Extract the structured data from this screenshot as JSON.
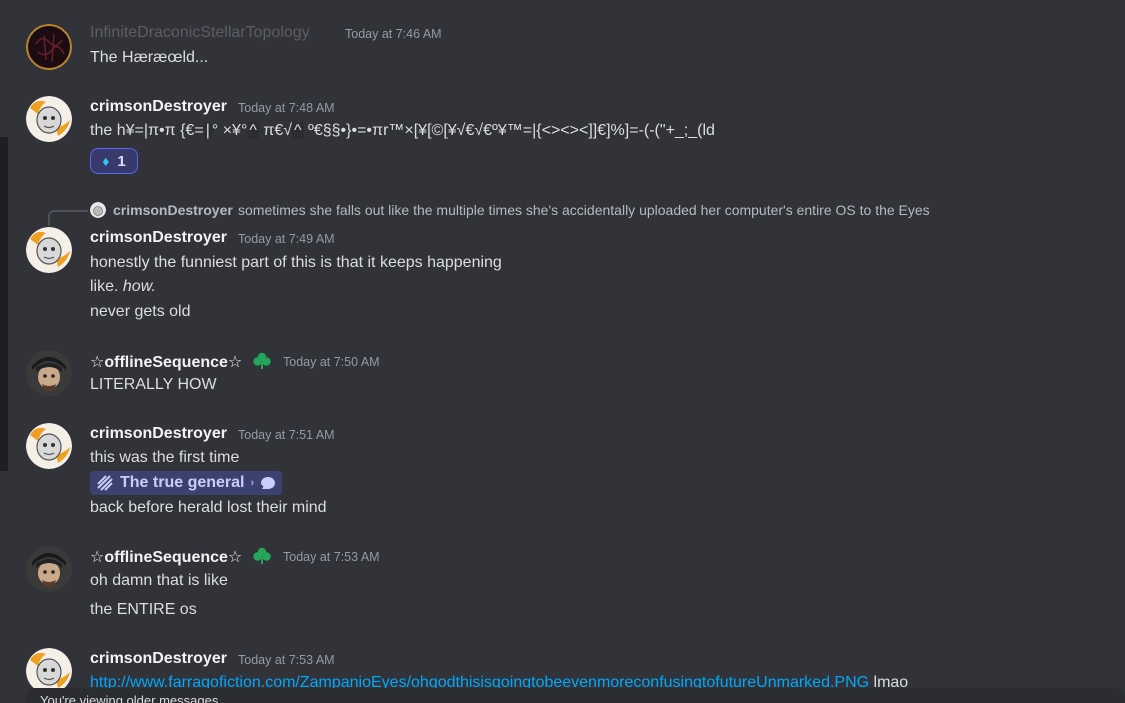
{
  "messages": [
    {
      "author": "InfiniteDraconicStellarTopology",
      "time": "Today at 7:46 AM",
      "lines": [
        "The Hæræœld..."
      ]
    },
    {
      "author": "crimsonDestroyer",
      "time": "Today at 7:48 AM",
      "line_parts": [
        "the h¥=|π•π {€=",
        "|",
        "° ×¥°",
        "^",
        " π€√",
        "^",
        " º€§§•}•=•πr™×[¥[©[¥√€√€º¥™=|{<><><]]€]%]=-(-(\"+_;_(ld"
      ],
      "reaction": {
        "emoji": "gem-icon",
        "count": "1"
      }
    },
    {
      "reply": {
        "author": "crimsonDestroyer",
        "text": "sometimes she falls out like the multiple times she's accidentally uploaded her computer's entire OS to the Eyes"
      },
      "author": "crimsonDestroyer",
      "time": "Today at 7:49 AM",
      "lines": [
        "honestly the funniest part of this is that it keeps happening",
        "like. ",
        "how.",
        "never gets old"
      ]
    },
    {
      "author": "☆offlineSequence☆",
      "time": "Today at 7:50 AM",
      "badge": "clover-badge-icon",
      "lines": [
        "LITERALLY HOW"
      ]
    },
    {
      "author": "crimsonDestroyer",
      "time": "Today at 7:51 AM",
      "lines": [
        "this was the first time",
        "back before herald lost their mind"
      ],
      "channel": {
        "name": "The true general",
        "icon": "forum-channel-icon",
        "trail_icon": "chat-bubble-icon"
      }
    },
    {
      "author": "☆offlineSequence☆",
      "time": "Today at 7:53 AM",
      "badge": "clover-badge-icon",
      "lines": [
        "oh damn that is like",
        "the ENTIRE os"
      ]
    },
    {
      "author": "crimsonDestroyer",
      "time": "Today at 7:53 AM",
      "link": "http://www.farragofiction.com/ZampanioEyes/ohgodthisisgoingtobeevenmoreconfusingtofutureUnmarked.PNG",
      "after_link": " lmao"
    }
  ],
  "banner": {
    "text": "You're viewing older messages"
  },
  "colors": {
    "background": "#313338",
    "link": "#00a8fc",
    "reaction_border": "#5865f2",
    "badge": "#23a55a"
  }
}
